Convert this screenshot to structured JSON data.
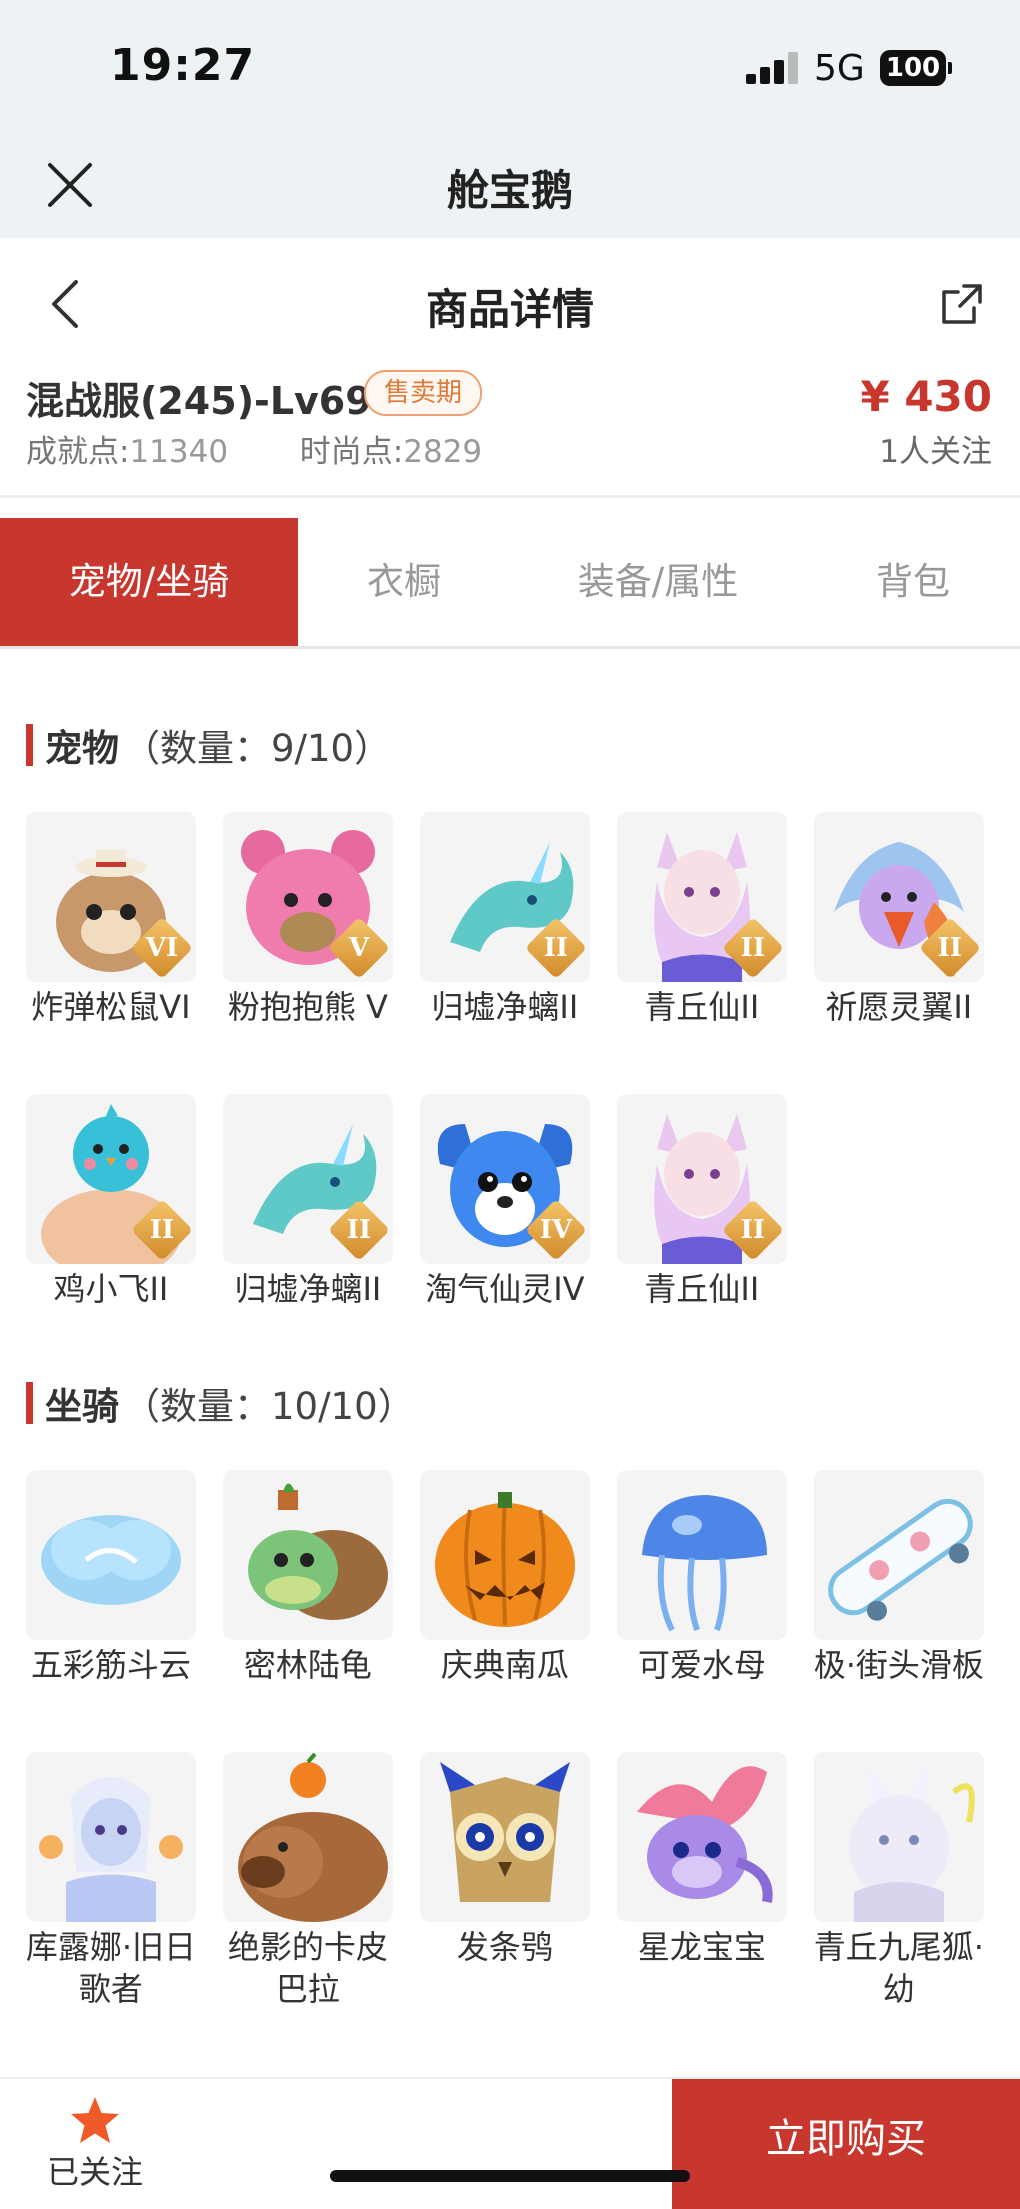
{
  "status_bar": {
    "time": "19:27",
    "network": "5G",
    "battery": "100"
  },
  "app_bar": {
    "title": "舱宝鹅"
  },
  "nav": {
    "title": "商品详情"
  },
  "product": {
    "server": "混战服(245)-Lv69",
    "status": "售卖期",
    "price": "¥ 430",
    "achievement_label": "成就点:",
    "achievement_value": "11340",
    "fashion_label": "时尚点:",
    "fashion_value": "2829",
    "followers": "1人关注"
  },
  "tabs": [
    "宠物/坐骑",
    "衣橱",
    "装备/属性",
    "背包"
  ],
  "pets": {
    "title": "宠物",
    "count": "（数量：9/10）",
    "items": [
      {
        "name": "炸弹松鼠VI",
        "grade": "VI",
        "art": "squirrel"
      },
      {
        "name": "粉抱抱熊 V",
        "grade": "V",
        "art": "pink-bear"
      },
      {
        "name": "归墟净螭II",
        "grade": "II",
        "art": "water-dragon"
      },
      {
        "name": "青丘仙II",
        "grade": "II",
        "art": "fox-fairy"
      },
      {
        "name": "祈愿灵翼II",
        "grade": "II",
        "art": "phoenix-bird"
      },
      {
        "name": "鸡小飞II",
        "grade": "II",
        "art": "chick-buff"
      },
      {
        "name": "归墟净螭II",
        "grade": "II",
        "art": "water-dragon"
      },
      {
        "name": "淘气仙灵IV",
        "grade": "IV",
        "art": "blue-puppy"
      },
      {
        "name": "青丘仙II",
        "grade": "II",
        "art": "fox-fairy"
      }
    ]
  },
  "mounts": {
    "title": "坐骑",
    "count": "（数量：10/10）",
    "items": [
      {
        "name": "五彩筋斗云",
        "art": "cloud"
      },
      {
        "name": "密林陆龟",
        "art": "turtle"
      },
      {
        "name": "庆典南瓜",
        "art": "pumpkin"
      },
      {
        "name": "可爱水母",
        "art": "jellyfish"
      },
      {
        "name": "极·街头滑板",
        "art": "skateboard"
      },
      {
        "name": "库露娜·旧日歌者",
        "art": "mermaid"
      },
      {
        "name": "绝影的卡皮巴拉",
        "art": "capybara"
      },
      {
        "name": "发条鸮",
        "art": "owl"
      },
      {
        "name": "星龙宝宝",
        "art": "baby-dragon"
      },
      {
        "name": "青丘九尾狐·幼",
        "art": "white-fox"
      }
    ]
  },
  "bottom": {
    "follow_label": "已关注",
    "buy_label": "立即购买"
  },
  "colors": {
    "accent": "#c8372d",
    "badge": "#e07a38",
    "star": "#f05a28"
  }
}
